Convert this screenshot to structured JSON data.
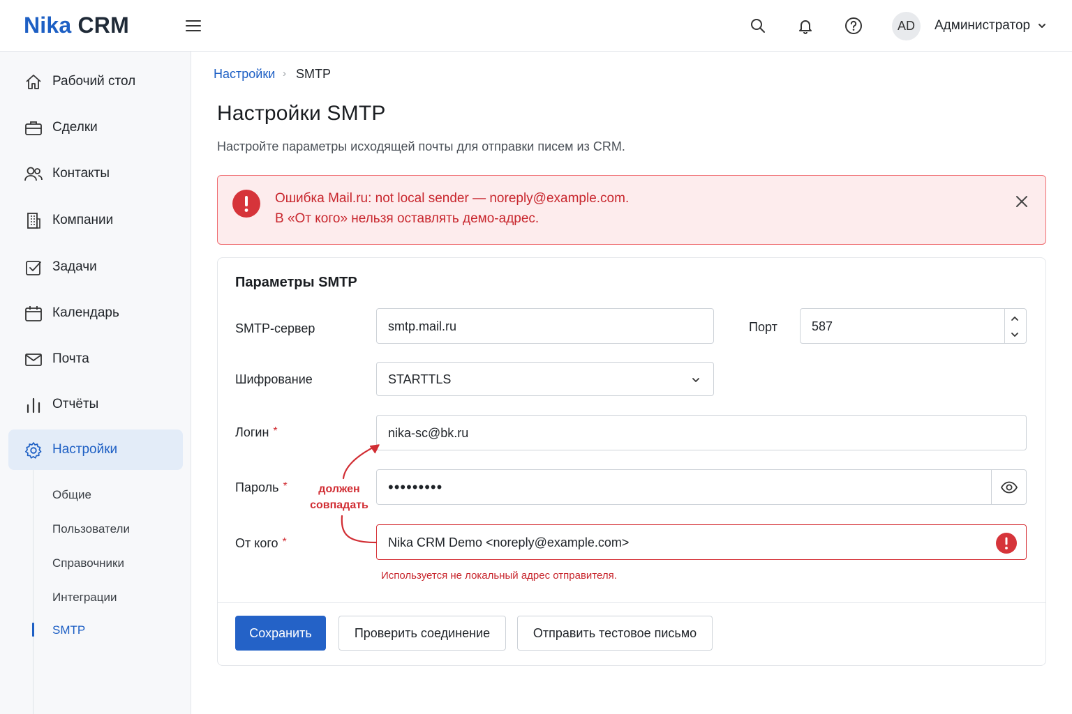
{
  "header": {
    "logo_part1": "Nika",
    "logo_part2": "CRM",
    "avatar_initials": "AD",
    "user_name": "Администратор"
  },
  "sidebar": {
    "items": [
      {
        "label": "Рабочий стол",
        "icon": "home-icon"
      },
      {
        "label": "Сделки",
        "icon": "briefcase-icon"
      },
      {
        "label": "Контакты",
        "icon": "users-icon"
      },
      {
        "label": "Компании",
        "icon": "building-icon"
      },
      {
        "label": "Задачи",
        "icon": "checkbox-icon"
      },
      {
        "label": "Календарь",
        "icon": "calendar-icon"
      },
      {
        "label": "Почта",
        "icon": "mail-icon"
      },
      {
        "label": "Отчёты",
        "icon": "bar-chart-icon"
      },
      {
        "label": "Настройки",
        "icon": "gear-icon",
        "active": true
      }
    ],
    "subitems": [
      {
        "label": "Общие"
      },
      {
        "label": "Пользователи"
      },
      {
        "label": "Справочники"
      },
      {
        "label": "Интеграции"
      },
      {
        "label": "SMTP",
        "active": true
      }
    ]
  },
  "breadcrumb": {
    "parent": "Настройки",
    "separator": "›",
    "current": "SMTP"
  },
  "page": {
    "title": "Настройки SMTP",
    "subtitle": "Настройте параметры исходящей почты для отправки писем из CRM."
  },
  "alert": {
    "line1": "Ошибка Mail.ru: not local sender — noreply@example.com.",
    "line2": "В «От кого» нельзя оставлять демо-адрес."
  },
  "form": {
    "title": "Параметры SMTP",
    "server_label": "SMTP-сервер",
    "server_value": "smtp.mail.ru",
    "port_label": "Порт",
    "port_value": "587",
    "encryption_label": "Шифрование",
    "encryption_value": "STARTTLS",
    "login_label": "Логин",
    "login_value": "nika-sc@bk.ru",
    "password_label": "Пароль",
    "password_value": "•••••••••",
    "from_label": "От кого",
    "from_value": "Nika CRM Demo <noreply@example.com>",
    "from_error": "Используется не локальный адрес отправителя.",
    "required_mark": "*"
  },
  "annotation": {
    "line1": "должен",
    "line2": "совпадать"
  },
  "buttons": {
    "save": "Сохранить",
    "check": "Проверить соединение",
    "test": "Отправить тестовое письмо"
  },
  "colors": {
    "accent": "#1d5fc4",
    "primary_button": "#2462c7",
    "error": "#d12d33",
    "alert_bg": "#fdeced"
  }
}
